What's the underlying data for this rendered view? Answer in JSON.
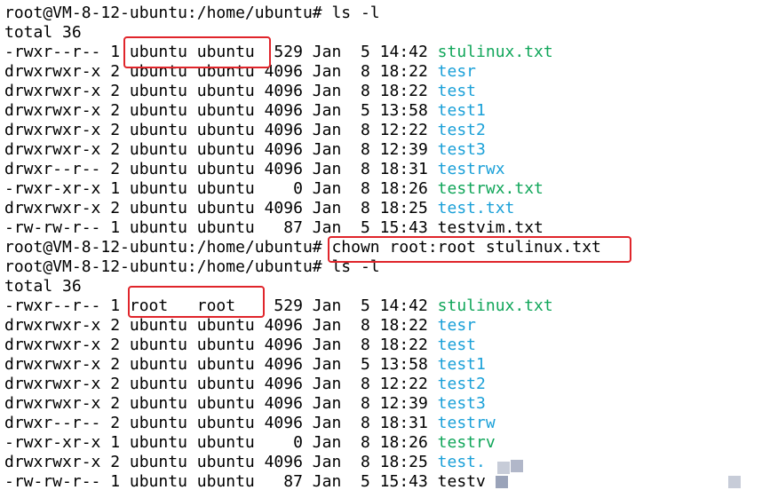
{
  "colors": {
    "background": "#ffffff",
    "text": "#000000",
    "file_green": "#11a65a",
    "dir_blue": "#1aa0d8",
    "highlight": "#e0252b"
  },
  "lines": [
    {
      "text": "root@VM-8-12-ubuntu:/home/ubuntu# ls -l",
      "name": ""
    },
    {
      "text": "total 36",
      "name": ""
    },
    {
      "text": "-rwxr--r-- 1 ubuntu ubuntu  529 Jan  5 14:42 ",
      "name": "stulinux.txt",
      "kind": "green"
    },
    {
      "text": "drwxrwxr-x 2 ubuntu ubuntu 4096 Jan  8 18:22 ",
      "name": "tesr",
      "kind": "blue"
    },
    {
      "text": "drwxrwxr-x 2 ubuntu ubuntu 4096 Jan  8 18:22 ",
      "name": "test",
      "kind": "blue"
    },
    {
      "text": "drwxrwxr-x 2 ubuntu ubuntu 4096 Jan  5 13:58 ",
      "name": "test1",
      "kind": "blue"
    },
    {
      "text": "drwxrwxr-x 2 ubuntu ubuntu 4096 Jan  8 12:22 ",
      "name": "test2",
      "kind": "blue"
    },
    {
      "text": "drwxrwxr-x 2 ubuntu ubuntu 4096 Jan  8 12:39 ",
      "name": "test3",
      "kind": "blue"
    },
    {
      "text": "drwxr--r-- 2 ubuntu ubuntu 4096 Jan  8 18:31 ",
      "name": "testrwx",
      "kind": "blue"
    },
    {
      "text": "-rwxr-xr-x 1 ubuntu ubuntu    0 Jan  8 18:26 ",
      "name": "testrwx.txt",
      "kind": "green"
    },
    {
      "text": "drwxrwxr-x 2 ubuntu ubuntu 4096 Jan  8 18:25 ",
      "name": "test.txt",
      "kind": "blue"
    },
    {
      "text": "-rw-rw-r-- 1 ubuntu ubuntu   87 Jan  5 15:43 ",
      "name": "testvim.txt",
      "kind": "plain"
    },
    {
      "text": "root@VM-8-12-ubuntu:/home/ubuntu# chown root:root stulinux.txt",
      "name": ""
    },
    {
      "text": "root@VM-8-12-ubuntu:/home/ubuntu# ls -l",
      "name": ""
    },
    {
      "text": "total 36",
      "name": ""
    },
    {
      "text": "-rwxr--r-- 1 root   root    529 Jan  5 14:42 ",
      "name": "stulinux.txt",
      "kind": "green"
    },
    {
      "text": "drwxrwxr-x 2 ubuntu ubuntu 4096 Jan  8 18:22 ",
      "name": "tesr",
      "kind": "blue"
    },
    {
      "text": "drwxrwxr-x 2 ubuntu ubuntu 4096 Jan  8 18:22 ",
      "name": "test",
      "kind": "blue"
    },
    {
      "text": "drwxrwxr-x 2 ubuntu ubuntu 4096 Jan  5 13:58 ",
      "name": "test1",
      "kind": "blue"
    },
    {
      "text": "drwxrwxr-x 2 ubuntu ubuntu 4096 Jan  8 12:22 ",
      "name": "test2",
      "kind": "blue"
    },
    {
      "text": "drwxrwxr-x 2 ubuntu ubuntu 4096 Jan  8 12:39 ",
      "name": "test3",
      "kind": "blue"
    },
    {
      "text": "drwxr--r-- 2 ubuntu ubuntu 4096 Jan  8 18:31 ",
      "name": "testrw",
      "kind": "blue"
    },
    {
      "text": "-rwxr-xr-x 1 ubuntu ubuntu    0 Jan  8 18:26 ",
      "name": "testrv",
      "kind": "green"
    },
    {
      "text": "drwxrwxr-x 2 ubuntu ubuntu 4096 Jan  8 18:25 ",
      "name": "test.",
      "kind": "blue"
    },
    {
      "text": "-rw-rw-r-- 1 ubuntu ubuntu   87 Jan  5 15:43 ",
      "name": "testv",
      "kind": "plain"
    }
  ]
}
